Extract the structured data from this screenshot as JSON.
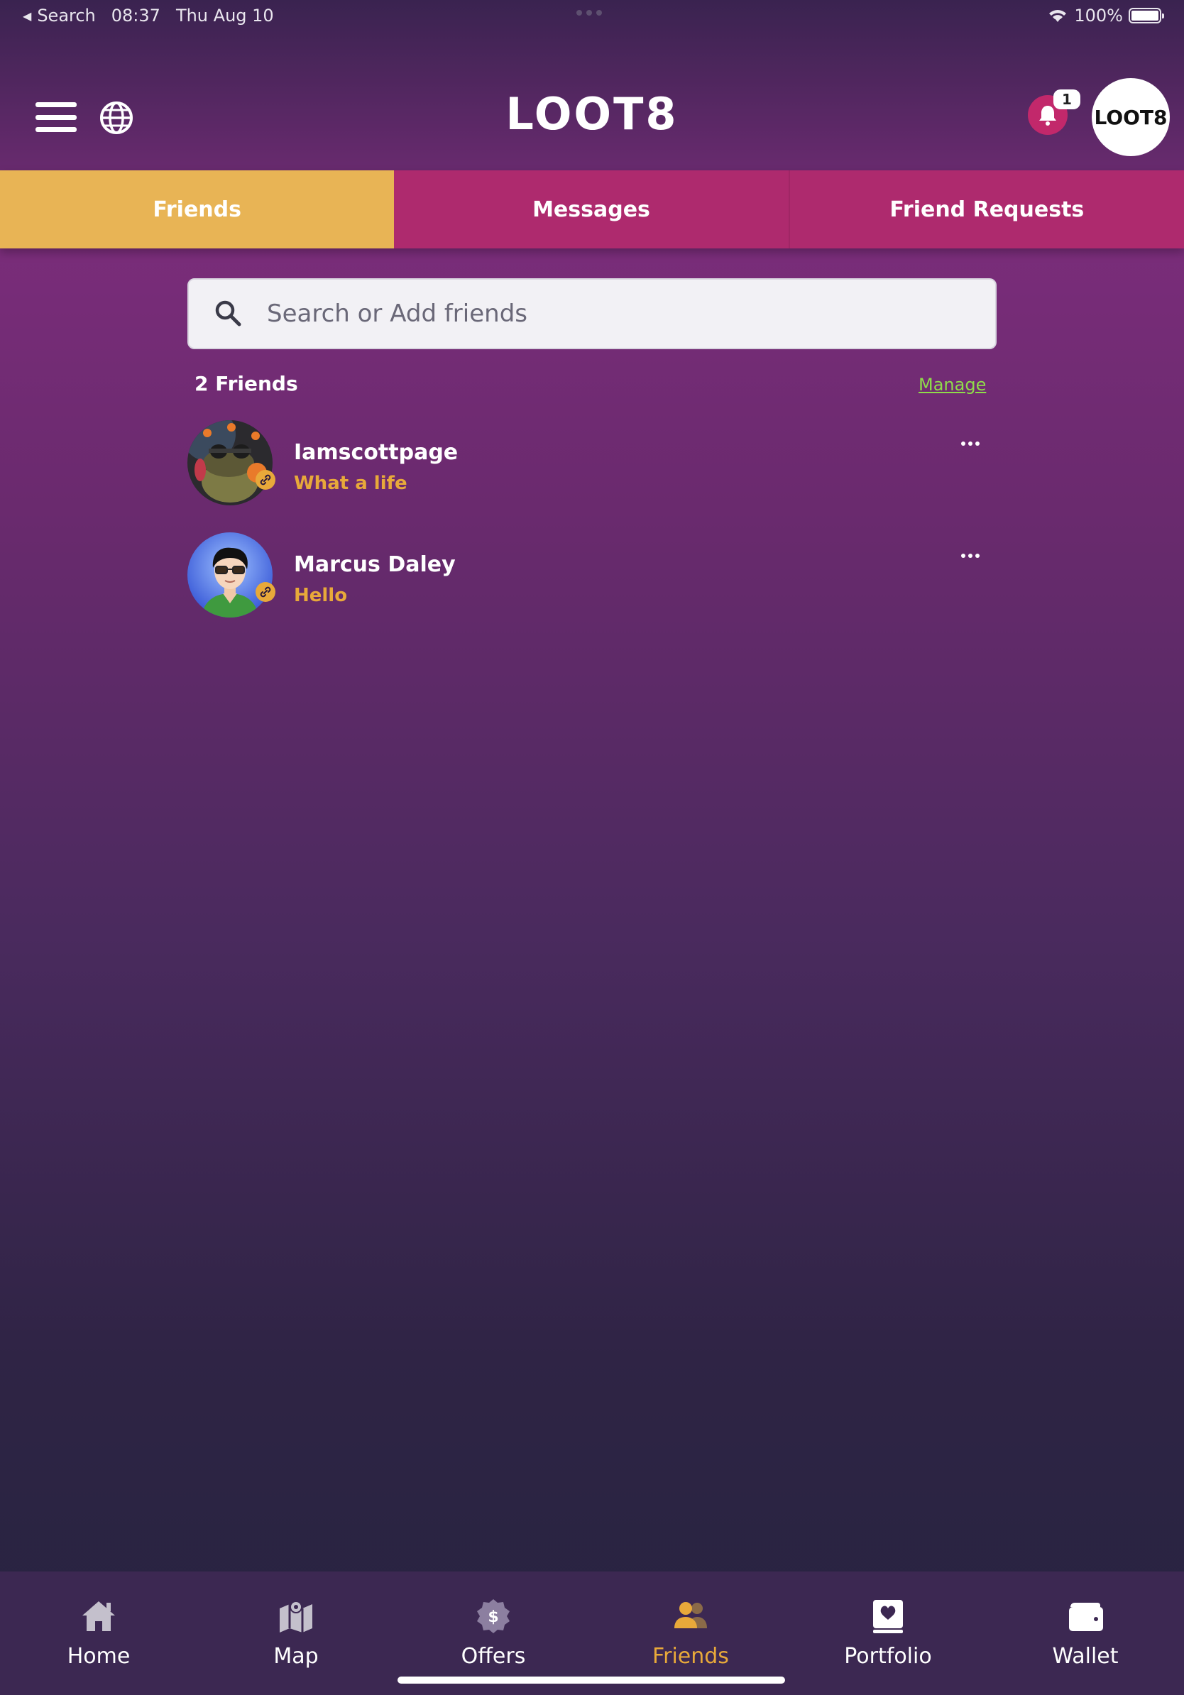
{
  "status_bar": {
    "back_label": "Search",
    "time": "08:37",
    "date": "Thu Aug 10",
    "battery": "100%"
  },
  "header": {
    "logo_text": "LOOT8",
    "notification_count": "1",
    "profile_logo_text": "LOOT8"
  },
  "tabs": [
    {
      "label": "Friends",
      "active": true
    },
    {
      "label": "Messages",
      "active": false
    },
    {
      "label": "Friend Requests",
      "active": false
    }
  ],
  "search": {
    "placeholder": "Search or Add friends",
    "value": ""
  },
  "friends": {
    "count_label": "2 Friends",
    "manage_label": "Manage",
    "items": [
      {
        "name": "Iamscottpage",
        "status": "What a life",
        "avatar": "frog-avatar"
      },
      {
        "name": "Marcus Daley",
        "status": "Hello",
        "avatar": "cartoon-man-avatar"
      }
    ]
  },
  "bottom_nav": [
    {
      "label": "Home",
      "icon": "home-icon",
      "active": false
    },
    {
      "label": "Map",
      "icon": "map-icon",
      "active": false
    },
    {
      "label": "Offers",
      "icon": "offers-badge-icon",
      "active": false
    },
    {
      "label": "Friends",
      "icon": "friends-icon",
      "active": true
    },
    {
      "label": "Portfolio",
      "icon": "portfolio-icon",
      "active": false
    },
    {
      "label": "Wallet",
      "icon": "wallet-icon",
      "active": false
    }
  ],
  "colors": {
    "accent_gold": "#e8b455",
    "tab_magenta": "#ae2a6e",
    "manage_green": "#8fdc4a",
    "status_orange": "#e8a93a"
  }
}
